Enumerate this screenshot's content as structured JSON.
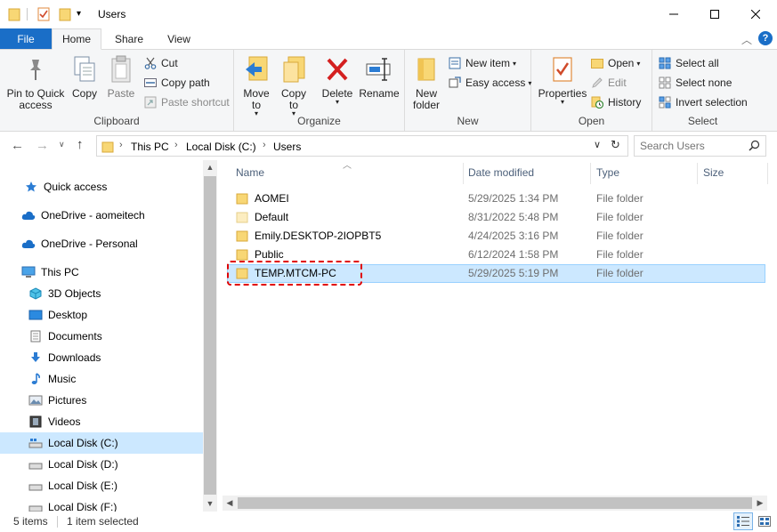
{
  "window": {
    "title": "Users",
    "minimize_icon": "minimize-icon",
    "maximize_icon": "maximize-icon",
    "close_icon": "close-icon"
  },
  "tabs": {
    "file": "File",
    "home": "Home",
    "share": "Share",
    "view": "View",
    "help": "?"
  },
  "ribbon": {
    "clipboard": {
      "label": "Clipboard",
      "pin_line1": "Pin to Quick",
      "pin_line2": "access",
      "copy": "Copy",
      "paste": "Paste",
      "cut": "Cut",
      "copy_path": "Copy path",
      "paste_shortcut": "Paste shortcut"
    },
    "organize": {
      "label": "Organize",
      "move_line1": "Move",
      "move_line2": "to",
      "copy_line1": "Copy",
      "copy_line2": "to",
      "delete": "Delete",
      "rename": "Rename"
    },
    "new": {
      "label": "New",
      "folder_line1": "New",
      "folder_line2": "folder",
      "new_item": "New item",
      "easy_access": "Easy access"
    },
    "open": {
      "label": "Open",
      "properties": "Properties",
      "open": "Open",
      "edit": "Edit",
      "history": "History"
    },
    "select": {
      "label": "Select",
      "select_all": "Select all",
      "select_none": "Select none",
      "invert": "Invert selection"
    }
  },
  "address": {
    "crumbs": [
      "This PC",
      "Local Disk (C:)",
      "Users"
    ],
    "search_placeholder": "Search Users"
  },
  "nav": {
    "items": [
      {
        "label": "Quick access",
        "icon": "star-icon"
      },
      {
        "label": "OneDrive - aomeitech",
        "icon": "cloud-icon"
      },
      {
        "label": "OneDrive - Personal",
        "icon": "cloud-icon"
      },
      {
        "label": "This PC",
        "icon": "computer-icon"
      },
      {
        "label": "3D Objects",
        "icon": "cube-icon"
      },
      {
        "label": "Desktop",
        "icon": "desktop-icon"
      },
      {
        "label": "Documents",
        "icon": "document-icon"
      },
      {
        "label": "Downloads",
        "icon": "download-icon"
      },
      {
        "label": "Music",
        "icon": "music-icon"
      },
      {
        "label": "Pictures",
        "icon": "picture-icon"
      },
      {
        "label": "Videos",
        "icon": "video-icon"
      },
      {
        "label": "Local Disk (C:)",
        "icon": "drive-icon"
      },
      {
        "label": "Local Disk (D:)",
        "icon": "drive-icon"
      },
      {
        "label": "Local Disk (E:)",
        "icon": "drive-icon"
      },
      {
        "label": "Local Disk (F:)",
        "icon": "drive-icon"
      }
    ]
  },
  "files": {
    "columns": [
      "Name",
      "Date modified",
      "Type",
      "Size"
    ],
    "rows": [
      {
        "name": "AOMEI",
        "date": "5/29/2025 1:34 PM",
        "type": "File folder"
      },
      {
        "name": "Default",
        "date": "8/31/2022 5:48 PM",
        "type": "File folder"
      },
      {
        "name": "Emily.DESKTOP-2IOPBT5",
        "date": "4/24/2025 3:16 PM",
        "type": "File folder"
      },
      {
        "name": "Public",
        "date": "6/12/2024 1:58 PM",
        "type": "File folder"
      },
      {
        "name": "TEMP.MTCM-PC",
        "date": "5/29/2025 5:19 PM",
        "type": "File folder"
      }
    ]
  },
  "status": {
    "item_count": "5 items",
    "selected": "1 item selected"
  }
}
